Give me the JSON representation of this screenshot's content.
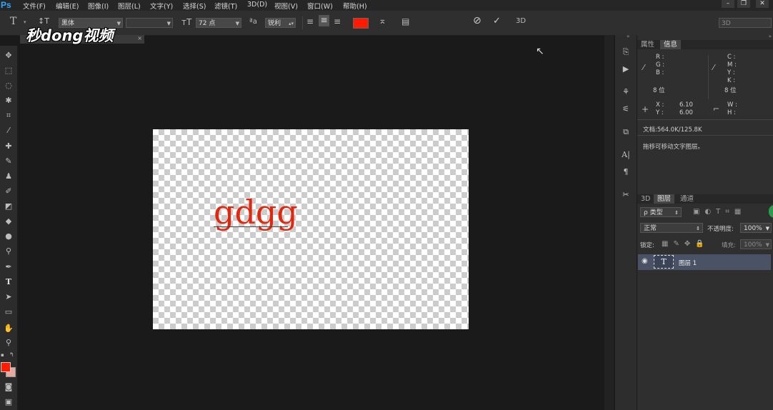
{
  "app": {
    "logo": "Ps"
  },
  "menubar": {
    "items": [
      "文件(F)",
      "编辑(E)",
      "图像(I)",
      "图层(L)",
      "文字(Y)",
      "选择(S)",
      "滤镜(T)",
      "3D(D)",
      "视图(V)",
      "窗口(W)",
      "帮助(H)"
    ]
  },
  "window_controls": [
    "–",
    "❐",
    "✕"
  ],
  "options": {
    "font_family": "黑体",
    "font_size": "72 点",
    "aa_label": "ªa",
    "antialias": "锐利",
    "text_color": "#ff1a00",
    "mode_3d": "3D",
    "workspace": "3D"
  },
  "watermark": "秒dong视频",
  "canvas": {
    "text": "gdgg",
    "text_color": "#e4260d"
  },
  "panels": {
    "top_tabs": [
      "属性",
      "信息"
    ],
    "info": {
      "rgb_labels": [
        "R :",
        "G :",
        "B :"
      ],
      "cmyk_labels": [
        "C :",
        "M :",
        "Y :",
        "K :"
      ],
      "bits_left": "8 位",
      "bits_right": "8 位",
      "x_label": "X :",
      "x_value": "6.10",
      "y_label": "Y :",
      "y_value": "6.00",
      "w_label": "W :",
      "h_label": "H :",
      "doc": "文档:564.0K/125.8K",
      "hint": "拖移可移动文字图层。"
    },
    "layer_tabs": [
      "3D",
      "图层",
      "通道"
    ],
    "filter_kind": "ρ 类型",
    "blend_mode": "正常",
    "opacity_label": "不透明度:",
    "opacity": "100%",
    "lock_label": "锁定:",
    "fill_label": "填充:",
    "fill": "100%",
    "layer": {
      "name": "图层 1",
      "thumb": "T"
    }
  }
}
